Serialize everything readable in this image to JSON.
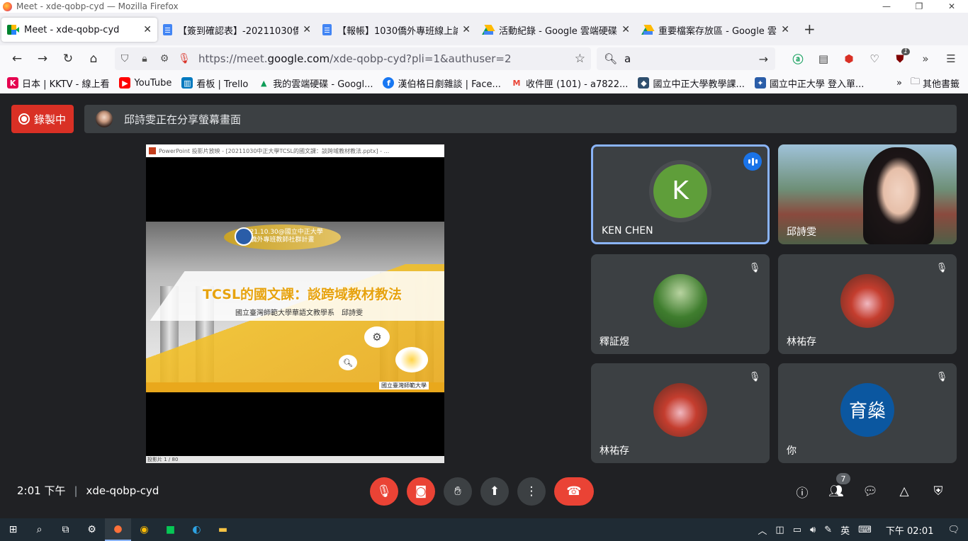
{
  "window": {
    "title": "Meet - xde-qobp-cyd — Mozilla Firefox"
  },
  "tabs": [
    {
      "label": "Meet - xde-qobp-cyd",
      "icon": "meet-icon",
      "active": true
    },
    {
      "label": "【簽到確認表】-20211030僑外",
      "icon": "docs-icon"
    },
    {
      "label": "【報帳】1030僑外專班線上論壇",
      "icon": "docs-icon"
    },
    {
      "label": "活動紀錄 - Google 雲端硬碟",
      "icon": "drive-icon"
    },
    {
      "label": "重要檔案存放區 - Google 雲端硬",
      "icon": "drive-icon"
    }
  ],
  "address": {
    "url_prefix": "https://meet.",
    "url_host": "google.com",
    "url_path": "/xde-qobp-cyd?pli=1&authuser=2"
  },
  "search": {
    "value": "a"
  },
  "bookmarks": [
    {
      "label": "日本 | KKTV - 線上看",
      "icon": "K",
      "color": "#e5004f"
    },
    {
      "label": "YouTube",
      "icon": "▶",
      "color": "#ff0000"
    },
    {
      "label": "看板 | Trello",
      "icon": "▥",
      "color": "#0079bf"
    },
    {
      "label": "我的雲端硬碟 - Googl...",
      "icon": "▲",
      "color": "#0f9d58"
    },
    {
      "label": "漢伯格日劇雜談 | Face...",
      "icon": "f",
      "color": "#1877f2"
    },
    {
      "label": "收件匣 (101) - a7822...",
      "icon": "M",
      "color": "#ea4335"
    },
    {
      "label": "國立中正大學教學課...",
      "icon": "◆",
      "color": "#2f4f6f"
    },
    {
      "label": "國立中正大學 登入單...",
      "icon": "✦",
      "color": "#2a5da8"
    }
  ],
  "bookmarks_other": "其他書籤",
  "meet": {
    "recording_label": "錄製中",
    "share_banner": "邱詩雯正在分享螢幕畫面",
    "ppt_window_title": "PowerPoint 投影片放映 - [20211030中正大學TCSL的國文課：談跨域教材教法.pptx] - ...",
    "slide": {
      "date_line": "2021.10.30@國立中正大學",
      "event_line": "僑外專班教師社群計畫",
      "title": "TCSL的國文課：談跨域教材教法",
      "subtitle": "國立臺灣師範大學華語文教學系　邱詩雯",
      "footer_logo": "國立臺灣師範大學",
      "status": "投影片 1 / 80"
    },
    "participants": [
      {
        "name": "KEN CHEN",
        "initial": "K",
        "color": "#5f9e3a",
        "speaking": true,
        "muted": false
      },
      {
        "name": "邱詩雯",
        "initial": "",
        "color": "#7b8f6d",
        "speaking": false,
        "muted": false,
        "video": true
      },
      {
        "name": "釋証煜",
        "initial": "",
        "color": "#4f7a3b",
        "speaking": false,
        "muted": true
      },
      {
        "name": "林祐存",
        "initial": "",
        "color": "#b44a3a",
        "speaking": false,
        "muted": true
      },
      {
        "name": "林祐存",
        "initial": "",
        "color": "#b44a3a",
        "speaking": false,
        "muted": true
      },
      {
        "name": "你",
        "initial": "育燊",
        "color": "#0b57a0",
        "speaking": false,
        "muted": true
      }
    ],
    "time": "2:01 下午",
    "meeting_code": "xde-qobp-cyd",
    "people_count": "7"
  },
  "taskbar": {
    "language": "英",
    "clock": "下午 02:01"
  }
}
